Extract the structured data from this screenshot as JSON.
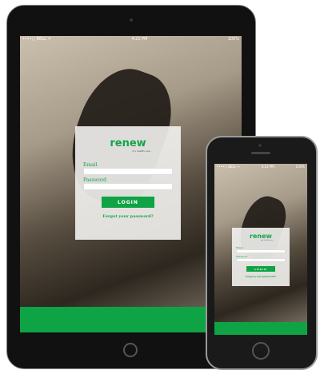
{
  "status_bar": {
    "carrier": "••••○ BELL ᯤ",
    "time": "4:21 PM",
    "battery": "100%"
  },
  "login": {
    "logo": "renew",
    "tagline": "my health care",
    "email_label": "Email",
    "password_label": "Password",
    "email_value": "",
    "password_value": "",
    "login_button": "LOGIN",
    "forgot_link": "Forgot your password?"
  },
  "colors": {
    "accent": "#0ea445"
  }
}
